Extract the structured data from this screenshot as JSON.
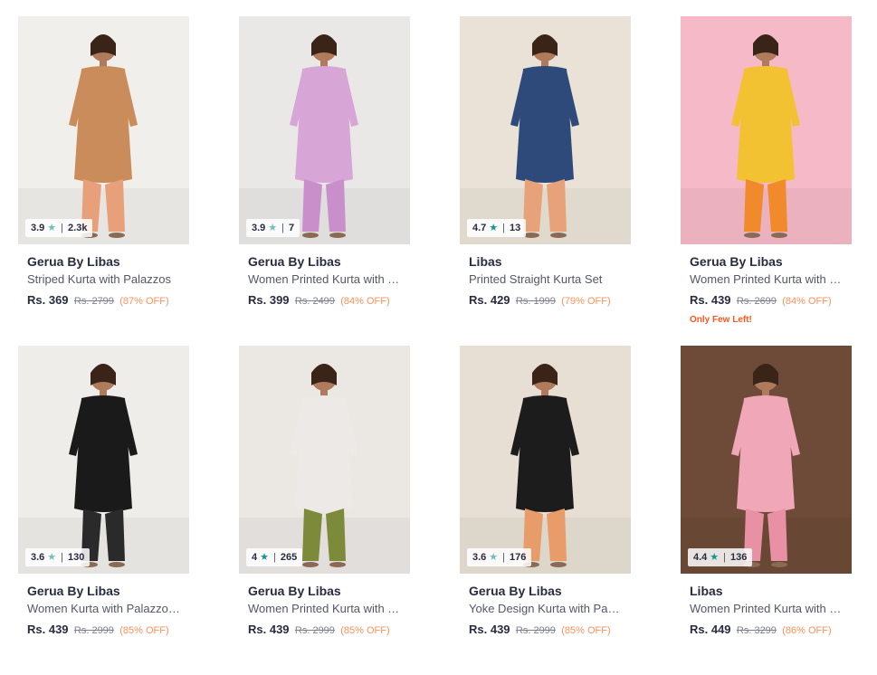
{
  "products": [
    {
      "brand": "Gerua By Libas",
      "name": "Striped Kurta with Palazzos",
      "price": "Rs. 369",
      "mrp": "Rs. 2799",
      "discount": "(87% OFF)",
      "rating": "3.9",
      "reviews": "2.3k",
      "star_color": "#72bfbc",
      "bg": "#f1efec",
      "outfit": "#c98c5a",
      "outfit2": "#e8a07a",
      "stock": ""
    },
    {
      "brand": "Gerua By Libas",
      "name": "Women Printed Kurta with Tr...",
      "price": "Rs. 399",
      "mrp": "Rs. 2499",
      "discount": "(84% OFF)",
      "rating": "3.9",
      "reviews": "7",
      "star_color": "#72bfbc",
      "bg": "#e9e8e6",
      "outfit": "#d7a6d6",
      "outfit2": "#c98fcb",
      "stock": ""
    },
    {
      "brand": "Libas",
      "name": "Printed Straight Kurta Set",
      "price": "Rs. 429",
      "mrp": "Rs. 1999",
      "discount": "(79% OFF)",
      "rating": "4.7",
      "reviews": "13",
      "star_color": "#14958f",
      "bg": "#eae2d6",
      "outfit": "#2d4a7a",
      "outfit2": "#e8a27a",
      "stock": ""
    },
    {
      "brand": "Gerua By Libas",
      "name": "Women Printed Kurta with H...",
      "price": "Rs. 439",
      "mrp": "Rs. 2699",
      "discount": "(84% OFF)",
      "rating": "",
      "reviews": "",
      "star_color": "#14958f",
      "bg": "#f5b9c7",
      "outfit": "#f2c233",
      "outfit2": "#f08a2b",
      "stock": "Only Few Left!"
    },
    {
      "brand": "Gerua By Libas",
      "name": "Women Kurta with Palazzos ...",
      "price": "Rs. 439",
      "mrp": "Rs. 2999",
      "discount": "(85% OFF)",
      "rating": "3.6",
      "reviews": "130",
      "star_color": "#72bfbc",
      "bg": "#efedea",
      "outfit": "#1a1a1a",
      "outfit2": "#2a2a2a",
      "stock": ""
    },
    {
      "brand": "Gerua By Libas",
      "name": "Women Printed Kurta with Tr...",
      "price": "Rs. 439",
      "mrp": "Rs. 2999",
      "discount": "(85% OFF)",
      "rating": "4",
      "reviews": "265",
      "star_color": "#14958f",
      "bg": "#ebe8e4",
      "outfit": "#ece9e6",
      "outfit2": "#7c8a3a",
      "stock": ""
    },
    {
      "brand": "Gerua By Libas",
      "name": "Yoke Design Kurta with Palaz...",
      "price": "Rs. 439",
      "mrp": "Rs. 2999",
      "discount": "(85% OFF)",
      "rating": "3.6",
      "reviews": "176",
      "star_color": "#72bfbc",
      "bg": "#e7dfd3",
      "outfit": "#1c1c1c",
      "outfit2": "#e89c6a",
      "stock": ""
    },
    {
      "brand": "Libas",
      "name": "Women Printed Kurta with P...",
      "price": "Rs. 449",
      "mrp": "Rs. 3299",
      "discount": "(86% OFF)",
      "rating": "4.4",
      "reviews": "136",
      "star_color": "#14958f",
      "bg": "#6e4a38",
      "outfit": "#f0a8b8",
      "outfit2": "#e890a4",
      "stock": ""
    }
  ]
}
